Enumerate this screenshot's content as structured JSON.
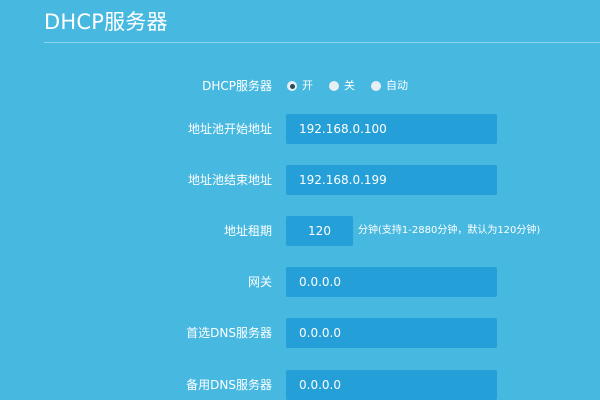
{
  "page": {
    "title": "DHCP服务器"
  },
  "form": {
    "dhcp_server": {
      "label": "DHCP服务器",
      "options": [
        {
          "label": "开",
          "checked": true
        },
        {
          "label": "关",
          "checked": false
        },
        {
          "label": "自动",
          "checked": false
        }
      ]
    },
    "pool_start": {
      "label": "地址池开始地址",
      "value": "192.168.0.100"
    },
    "pool_end": {
      "label": "地址池结束地址",
      "value": "192.168.0.199"
    },
    "lease": {
      "label": "地址租期",
      "value": "120",
      "hint": "分钟(支持1-2880分钟，默认为120分钟)"
    },
    "gateway": {
      "label": "网关",
      "value": "0.0.0.0"
    },
    "primary_dns": {
      "label": "首选DNS服务器",
      "value": "0.0.0.0"
    },
    "secondary_dns": {
      "label": "备用DNS服务器",
      "value": "0.0.0.0"
    }
  },
  "colors": {
    "background": "#47b9e1",
    "input_background": "#249fd8",
    "text": "#ffffff"
  }
}
